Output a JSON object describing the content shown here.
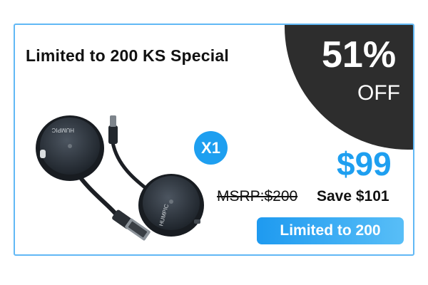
{
  "promo": {
    "title": "Limited to 200 KS Special",
    "discount_percent": "51%",
    "discount_off": "OFF",
    "quantity": "X1",
    "price": "$99",
    "msrp": "MSRP:$200",
    "save": "Save $101",
    "limit_button": "Limited to 200"
  },
  "product": {
    "device_brand": "HUMPIC",
    "icon": "wireless-hdmi-transmitter-image"
  },
  "colors": {
    "accent_blue": "#1e9ff0",
    "border_blue": "#61b8f5",
    "dark_badge": "#2d2d2d"
  }
}
